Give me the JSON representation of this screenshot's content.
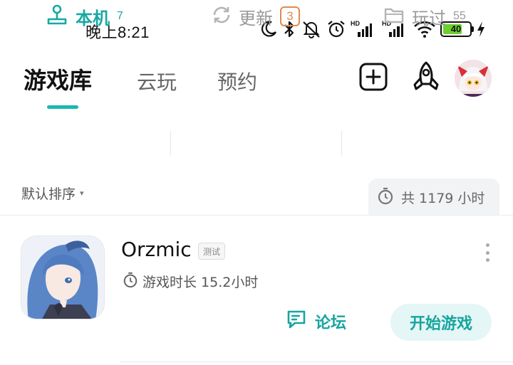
{
  "status_bar": {
    "time": "晚上8:21",
    "signal1_label": "HD",
    "signal2_label": "HD",
    "battery_level": "40",
    "icons": [
      "moon-icon",
      "bluetooth-icon",
      "mute-icon",
      "alarm-icon",
      "signal-icon",
      "signal-icon",
      "wifi-icon",
      "battery-icon",
      "charging-icon"
    ]
  },
  "header": {
    "tabs": [
      {
        "label": "游戏库",
        "active": true
      },
      {
        "label": "云玩",
        "active": false
      },
      {
        "label": "预约",
        "active": false
      }
    ],
    "add_icon": "plus-square-icon",
    "rocket_icon": "rocket-icon",
    "accent_color": "#19b8b1"
  },
  "subtabs": [
    {
      "icon": "joystick-icon",
      "label": "本机",
      "count": "7"
    },
    {
      "icon": "refresh-icon",
      "label": "更新",
      "count": "3"
    },
    {
      "icon": "folder-icon",
      "label": "玩过",
      "count": "55"
    }
  ],
  "sort": {
    "label": "默认排序",
    "caret": "▾"
  },
  "total": {
    "icon": "stopwatch-icon",
    "text": "共 1179 小时"
  },
  "games": [
    {
      "title": "Orzmic",
      "tag": "测试",
      "playtime": "游戏时长 15.2小时",
      "forum_label": "论坛",
      "start_label": "开始游戏"
    }
  ]
}
